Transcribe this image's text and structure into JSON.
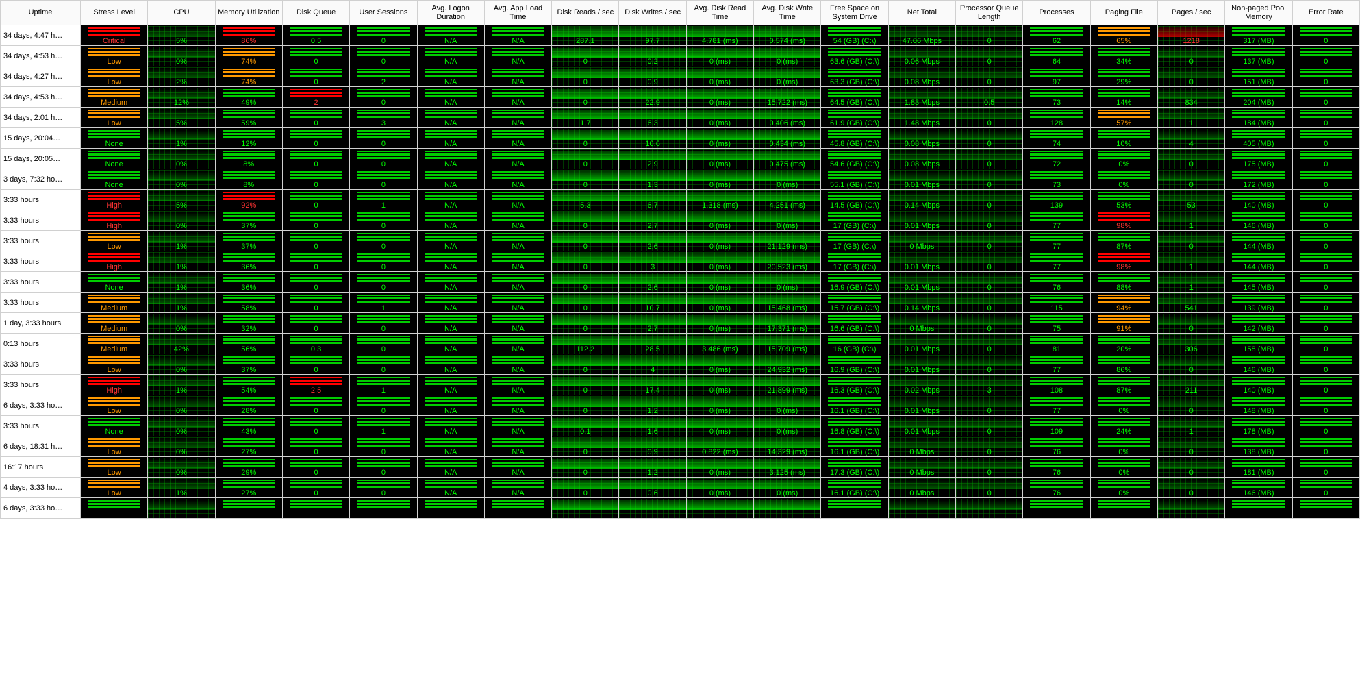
{
  "columns": [
    "Uptime",
    "Stress Level",
    "CPU",
    "Memory Utilization",
    "Disk Queue",
    "User Sessions",
    "Avg. Logon Duration",
    "Avg. App Load Time",
    "Disk Reads / sec",
    "Disk Writes / sec",
    "Avg. Disk Read Time",
    "Avg. Disk Write Time",
    "Free Space on System Drive",
    "Net Total",
    "Processor Queue Length",
    "Processes",
    "Paging File",
    "Pages / sec",
    "Non-paged Pool Memory",
    "Error Rate"
  ],
  "rows": [
    {
      "uptime": "34 days, 4:47 h…",
      "stress": {
        "label": "Critical",
        "sev": "critical"
      },
      "cpu": "5%",
      "mem": {
        "v": "86%",
        "sev": "high"
      },
      "dq": "0.5",
      "sess": "0",
      "logon": "N/A",
      "appload": "N/A",
      "dr": "287.1",
      "dw": "97.7",
      "drt": "4.781 (ms)",
      "dwt": "0.574 (ms)",
      "free": "54 (GB) (C:\\)",
      "net": "47.06 Mbps",
      "pql": "0",
      "proc": "62",
      "pf": {
        "v": "65%",
        "sev": "medium"
      },
      "pps": {
        "v": "1218",
        "sev": "red"
      },
      "npm": "317 (MB)",
      "err": "0"
    },
    {
      "uptime": "34 days, 4:53 h…",
      "stress": {
        "label": "Low",
        "sev": "low"
      },
      "cpu": "0%",
      "mem": {
        "v": "74%",
        "sev": "medium"
      },
      "dq": "0",
      "sess": "0",
      "logon": "N/A",
      "appload": "N/A",
      "dr": "0",
      "dw": "0.2",
      "drt": "0 (ms)",
      "dwt": "0 (ms)",
      "free": "63.6 (GB) (C:\\)",
      "net": "0.06 Mbps",
      "pql": "0",
      "proc": "64",
      "pf": {
        "v": "34%",
        "sev": "none"
      },
      "pps": {
        "v": "0",
        "sev": "none"
      },
      "npm": "137 (MB)",
      "err": "0"
    },
    {
      "uptime": "34 days, 4:27 h…",
      "stress": {
        "label": "Low",
        "sev": "low"
      },
      "cpu": "2%",
      "mem": {
        "v": "74%",
        "sev": "medium"
      },
      "dq": "0",
      "sess": "2",
      "logon": "N/A",
      "appload": "N/A",
      "dr": "0",
      "dw": "0.9",
      "drt": "0 (ms)",
      "dwt": "0 (ms)",
      "free": "63.3 (GB) (C:\\)",
      "net": "0.08 Mbps",
      "pql": "0",
      "proc": "97",
      "pf": {
        "v": "29%",
        "sev": "none"
      },
      "pps": {
        "v": "0",
        "sev": "none"
      },
      "npm": "151 (MB)",
      "err": "0"
    },
    {
      "uptime": "34 days, 4:53 h…",
      "stress": {
        "label": "Medium",
        "sev": "medium"
      },
      "cpu": "12%",
      "mem": {
        "v": "49%",
        "sev": "none"
      },
      "dq": {
        "v": "2",
        "sev": "critical"
      },
      "sess": "0",
      "logon": "N/A",
      "appload": "N/A",
      "dr": "0",
      "dw": "22.9",
      "drt": "0 (ms)",
      "dwt": "15.722 (ms)",
      "free": "64.5 (GB) (C:\\)",
      "net": "1.83 Mbps",
      "pql": "0.5",
      "proc": "73",
      "pf": {
        "v": "14%",
        "sev": "none"
      },
      "pps": {
        "v": "834",
        "sev": "none"
      },
      "npm": "204 (MB)",
      "err": "0"
    },
    {
      "uptime": "34 days, 2:01 h…",
      "stress": {
        "label": "Low",
        "sev": "low"
      },
      "cpu": "5%",
      "mem": {
        "v": "59%",
        "sev": "none"
      },
      "dq": "0",
      "sess": "3",
      "logon": "N/A",
      "appload": "N/A",
      "dr": "1.7",
      "dw": "6.3",
      "drt": "0 (ms)",
      "dwt": "0.406 (ms)",
      "free": "61.9 (GB) (C:\\)",
      "net": "1.48 Mbps",
      "pql": "0",
      "proc": "128",
      "pf": {
        "v": "57%",
        "sev": "medium"
      },
      "pps": {
        "v": "1",
        "sev": "none"
      },
      "npm": "184 (MB)",
      "err": "0"
    },
    {
      "uptime": "15 days, 20:04…",
      "stress": {
        "label": "None",
        "sev": "none"
      },
      "cpu": "1%",
      "mem": {
        "v": "12%",
        "sev": "none"
      },
      "dq": "0",
      "sess": "0",
      "logon": "N/A",
      "appload": "N/A",
      "dr": "0",
      "dw": "10.6",
      "drt": "0 (ms)",
      "dwt": "0.434 (ms)",
      "free": "45.8 (GB) (C:\\)",
      "net": "0.08 Mbps",
      "pql": "0",
      "proc": "74",
      "pf": {
        "v": "10%",
        "sev": "none"
      },
      "pps": {
        "v": "4",
        "sev": "none"
      },
      "npm": "405 (MB)",
      "err": "0"
    },
    {
      "uptime": "15 days, 20:05…",
      "stress": {
        "label": "None",
        "sev": "none"
      },
      "cpu": "0%",
      "mem": {
        "v": "8%",
        "sev": "none"
      },
      "dq": "0",
      "sess": "0",
      "logon": "N/A",
      "appload": "N/A",
      "dr": "0",
      "dw": "2.9",
      "drt": "0 (ms)",
      "dwt": "0.475 (ms)",
      "free": "54.6 (GB) (C:\\)",
      "net": "0.08 Mbps",
      "pql": "0",
      "proc": "72",
      "pf": {
        "v": "0%",
        "sev": "none"
      },
      "pps": {
        "v": "0",
        "sev": "none"
      },
      "npm": "175 (MB)",
      "err": "0"
    },
    {
      "uptime": "3 days, 7:32 ho…",
      "stress": {
        "label": "None",
        "sev": "none"
      },
      "cpu": "0%",
      "mem": {
        "v": "8%",
        "sev": "none"
      },
      "dq": "0",
      "sess": "0",
      "logon": "N/A",
      "appload": "N/A",
      "dr": "0",
      "dw": "1.3",
      "drt": "0 (ms)",
      "dwt": "0 (ms)",
      "free": "55.1 (GB) (C:\\)",
      "net": "0.01 Mbps",
      "pql": "0",
      "proc": "73",
      "pf": {
        "v": "0%",
        "sev": "none"
      },
      "pps": {
        "v": "0",
        "sev": "none"
      },
      "npm": "172 (MB)",
      "err": "0"
    },
    {
      "uptime": "3:33 hours",
      "stress": {
        "label": "High",
        "sev": "high"
      },
      "cpu": "5%",
      "mem": {
        "v": "92%",
        "sev": "high"
      },
      "dq": "0",
      "sess": "1",
      "logon": "N/A",
      "appload": "N/A",
      "dr": "5.3",
      "dw": "6.7",
      "drt": "1.318 (ms)",
      "dwt": "4.251 (ms)",
      "free": "14.5 (GB) (C:\\)",
      "net": "0.14 Mbps",
      "pql": "0",
      "proc": "139",
      "pf": {
        "v": "53%",
        "sev": "none"
      },
      "pps": {
        "v": "53",
        "sev": "none"
      },
      "npm": "140 (MB)",
      "err": "0"
    },
    {
      "uptime": "3:33 hours",
      "stress": {
        "label": "High",
        "sev": "high"
      },
      "cpu": "0%",
      "mem": {
        "v": "37%",
        "sev": "none"
      },
      "dq": "0",
      "sess": "0",
      "logon": "N/A",
      "appload": "N/A",
      "dr": "0",
      "dw": "2.7",
      "drt": "0 (ms)",
      "dwt": "0 (ms)",
      "free": "17 (GB) (C:\\)",
      "net": "0.01 Mbps",
      "pql": "0",
      "proc": "77",
      "pf": {
        "v": "98%",
        "sev": "critical"
      },
      "pps": {
        "v": "1",
        "sev": "none"
      },
      "npm": "146 (MB)",
      "err": "0"
    },
    {
      "uptime": "3:33 hours",
      "stress": {
        "label": "Low",
        "sev": "low"
      },
      "cpu": "1%",
      "mem": {
        "v": "37%",
        "sev": "none"
      },
      "dq": "0",
      "sess": "0",
      "logon": "N/A",
      "appload": "N/A",
      "dr": "0",
      "dw": "2.6",
      "drt": "0 (ms)",
      "dwt": "21.129 (ms)",
      "free": "17 (GB) (C:\\)",
      "net": "0 Mbps",
      "pql": "0",
      "proc": "77",
      "pf": {
        "v": "87%",
        "sev": "none"
      },
      "pps": {
        "v": "0",
        "sev": "none"
      },
      "npm": "144 (MB)",
      "err": "0"
    },
    {
      "uptime": "3:33 hours",
      "stress": {
        "label": "High",
        "sev": "high"
      },
      "cpu": "1%",
      "mem": {
        "v": "36%",
        "sev": "none"
      },
      "dq": "0",
      "sess": "0",
      "logon": "N/A",
      "appload": "N/A",
      "dr": "0",
      "dw": "3",
      "drt": "0 (ms)",
      "dwt": "20.523 (ms)",
      "free": "17 (GB) (C:\\)",
      "net": "0.01 Mbps",
      "pql": "0",
      "proc": "77",
      "pf": {
        "v": "98%",
        "sev": "critical"
      },
      "pps": {
        "v": "1",
        "sev": "none"
      },
      "npm": "144 (MB)",
      "err": "0"
    },
    {
      "uptime": "3:33 hours",
      "stress": {
        "label": "None",
        "sev": "none"
      },
      "cpu": "1%",
      "mem": {
        "v": "36%",
        "sev": "none"
      },
      "dq": "0",
      "sess": "0",
      "logon": "N/A",
      "appload": "N/A",
      "dr": "0",
      "dw": "2.6",
      "drt": "0 (ms)",
      "dwt": "0 (ms)",
      "free": "16.9 (GB) (C:\\)",
      "net": "0.01 Mbps",
      "pql": "0",
      "proc": "76",
      "pf": {
        "v": "88%",
        "sev": "none"
      },
      "pps": {
        "v": "1",
        "sev": "none"
      },
      "npm": "145 (MB)",
      "err": "0"
    },
    {
      "uptime": "3:33 hours",
      "stress": {
        "label": "Medium",
        "sev": "medium"
      },
      "cpu": "1%",
      "mem": {
        "v": "58%",
        "sev": "none"
      },
      "dq": "0",
      "sess": "1",
      "logon": "N/A",
      "appload": "N/A",
      "dr": "0",
      "dw": "10.7",
      "drt": "0 (ms)",
      "dwt": "15.468 (ms)",
      "free": "15.7 (GB) (C:\\)",
      "net": "0.14 Mbps",
      "pql": "0",
      "proc": "115",
      "pf": {
        "v": "94%",
        "sev": "medium"
      },
      "pps": {
        "v": "541",
        "sev": "none"
      },
      "npm": "139 (MB)",
      "err": "0"
    },
    {
      "uptime": "1 day, 3:33 hours",
      "stress": {
        "label": "Medium",
        "sev": "medium"
      },
      "cpu": "0%",
      "mem": {
        "v": "32%",
        "sev": "none"
      },
      "dq": "0",
      "sess": "0",
      "logon": "N/A",
      "appload": "N/A",
      "dr": "0",
      "dw": "2.7",
      "drt": "0 (ms)",
      "dwt": "17.371 (ms)",
      "free": "16.6 (GB) (C:\\)",
      "net": "0 Mbps",
      "pql": "0",
      "proc": "75",
      "pf": {
        "v": "91%",
        "sev": "medium"
      },
      "pps": {
        "v": "0",
        "sev": "none"
      },
      "npm": "142 (MB)",
      "err": "0"
    },
    {
      "uptime": "0:13 hours",
      "stress": {
        "label": "Medium",
        "sev": "medium"
      },
      "cpu": "42%",
      "mem": {
        "v": "56%",
        "sev": "none"
      },
      "dq": "0.3",
      "sess": "0",
      "logon": "N/A",
      "appload": "N/A",
      "dr": "112.2",
      "dw": "28.5",
      "drt": "3.486 (ms)",
      "dwt": "15.709 (ms)",
      "free": "16 (GB) (C:\\)",
      "net": "0.01 Mbps",
      "pql": "0",
      "proc": "81",
      "pf": {
        "v": "20%",
        "sev": "none"
      },
      "pps": {
        "v": "306",
        "sev": "none"
      },
      "npm": "158 (MB)",
      "err": "0"
    },
    {
      "uptime": "3:33 hours",
      "stress": {
        "label": "Low",
        "sev": "low"
      },
      "cpu": "0%",
      "mem": {
        "v": "37%",
        "sev": "none"
      },
      "dq": "0",
      "sess": "0",
      "logon": "N/A",
      "appload": "N/A",
      "dr": "0",
      "dw": "4",
      "drt": "0 (ms)",
      "dwt": "24.932 (ms)",
      "free": "16.9 (GB) (C:\\)",
      "net": "0.01 Mbps",
      "pql": "0",
      "proc": "77",
      "pf": {
        "v": "86%",
        "sev": "none"
      },
      "pps": {
        "v": "0",
        "sev": "none"
      },
      "npm": "146 (MB)",
      "err": "0"
    },
    {
      "uptime": "3:33 hours",
      "stress": {
        "label": "High",
        "sev": "high"
      },
      "cpu": "1%",
      "mem": {
        "v": "54%",
        "sev": "none"
      },
      "dq": {
        "v": "2.5",
        "sev": "critical"
      },
      "sess": "1",
      "logon": "N/A",
      "appload": "N/A",
      "dr": "0",
      "dw": "17.4",
      "drt": "0 (ms)",
      "dwt": "21.899 (ms)",
      "free": "16.3 (GB) (C:\\)",
      "net": "0.02 Mbps",
      "pql": "3",
      "proc": "108",
      "pf": {
        "v": "87%",
        "sev": "none"
      },
      "pps": {
        "v": "211",
        "sev": "none"
      },
      "npm": "140 (MB)",
      "err": "0"
    },
    {
      "uptime": "6 days, 3:33 ho…",
      "stress": {
        "label": "Low",
        "sev": "low"
      },
      "cpu": "0%",
      "mem": {
        "v": "28%",
        "sev": "none"
      },
      "dq": "0",
      "sess": "0",
      "logon": "N/A",
      "appload": "N/A",
      "dr": "0",
      "dw": "1.2",
      "drt": "0 (ms)",
      "dwt": "0 (ms)",
      "free": "16.1 (GB) (C:\\)",
      "net": "0.01 Mbps",
      "pql": "0",
      "proc": "77",
      "pf": {
        "v": "0%",
        "sev": "none"
      },
      "pps": {
        "v": "0",
        "sev": "none"
      },
      "npm": "148 (MB)",
      "err": "0"
    },
    {
      "uptime": "3:33 hours",
      "stress": {
        "label": "None",
        "sev": "none"
      },
      "cpu": "0%",
      "mem": {
        "v": "43%",
        "sev": "none"
      },
      "dq": "0",
      "sess": "1",
      "logon": "N/A",
      "appload": "N/A",
      "dr": "0.1",
      "dw": "1.6",
      "drt": "0 (ms)",
      "dwt": "0 (ms)",
      "free": "16.8 (GB) (C:\\)",
      "net": "0.01 Mbps",
      "pql": "0",
      "proc": "109",
      "pf": {
        "v": "24%",
        "sev": "none"
      },
      "pps": {
        "v": "1",
        "sev": "none"
      },
      "npm": "178 (MB)",
      "err": "0"
    },
    {
      "uptime": "6 days, 18:31 h…",
      "stress": {
        "label": "Low",
        "sev": "low"
      },
      "cpu": "0%",
      "mem": {
        "v": "27%",
        "sev": "none"
      },
      "dq": "0",
      "sess": "0",
      "logon": "N/A",
      "appload": "N/A",
      "dr": "0",
      "dw": "0.9",
      "drt": "0.822 (ms)",
      "dwt": "14.329 (ms)",
      "free": "16.1 (GB) (C:\\)",
      "net": "0 Mbps",
      "pql": "0",
      "proc": "76",
      "pf": {
        "v": "0%",
        "sev": "none"
      },
      "pps": {
        "v": "0",
        "sev": "none"
      },
      "npm": "138 (MB)",
      "err": "0"
    },
    {
      "uptime": "16:17 hours",
      "stress": {
        "label": "Low",
        "sev": "low"
      },
      "cpu": "0%",
      "mem": {
        "v": "29%",
        "sev": "none"
      },
      "dq": "0",
      "sess": "0",
      "logon": "N/A",
      "appload": "N/A",
      "dr": "0",
      "dw": "1.2",
      "drt": "0 (ms)",
      "dwt": "3.125 (ms)",
      "free": "17.3 (GB) (C:\\)",
      "net": "0 Mbps",
      "pql": "0",
      "proc": "76",
      "pf": {
        "v": "0%",
        "sev": "none"
      },
      "pps": {
        "v": "0",
        "sev": "none"
      },
      "npm": "181 (MB)",
      "err": "0"
    },
    {
      "uptime": "4 days, 3:33 ho…",
      "stress": {
        "label": "Low",
        "sev": "low"
      },
      "cpu": "1%",
      "mem": {
        "v": "27%",
        "sev": "none"
      },
      "dq": "0",
      "sess": "0",
      "logon": "N/A",
      "appload": "N/A",
      "dr": "0",
      "dw": "0.6",
      "drt": "0 (ms)",
      "dwt": "0 (ms)",
      "free": "16.1 (GB) (C:\\)",
      "net": "0 Mbps",
      "pql": "0",
      "proc": "76",
      "pf": {
        "v": "0%",
        "sev": "none"
      },
      "pps": {
        "v": "0",
        "sev": "none"
      },
      "npm": "146 (MB)",
      "err": "0"
    },
    {
      "uptime": "6 days, 3:33 ho…",
      "stress": {
        "label": "",
        "sev": ""
      },
      "cpu": "",
      "mem": {
        "v": "",
        "sev": ""
      },
      "dq": "",
      "sess": "",
      "logon": "",
      "appload": "",
      "dr": "",
      "dw": "",
      "drt": "",
      "dwt": "",
      "free": "",
      "net": "",
      "pql": "",
      "proc": "",
      "pf": {
        "v": "",
        "sev": ""
      },
      "pps": {
        "v": "",
        "sev": ""
      },
      "npm": "",
      "err": ""
    }
  ]
}
